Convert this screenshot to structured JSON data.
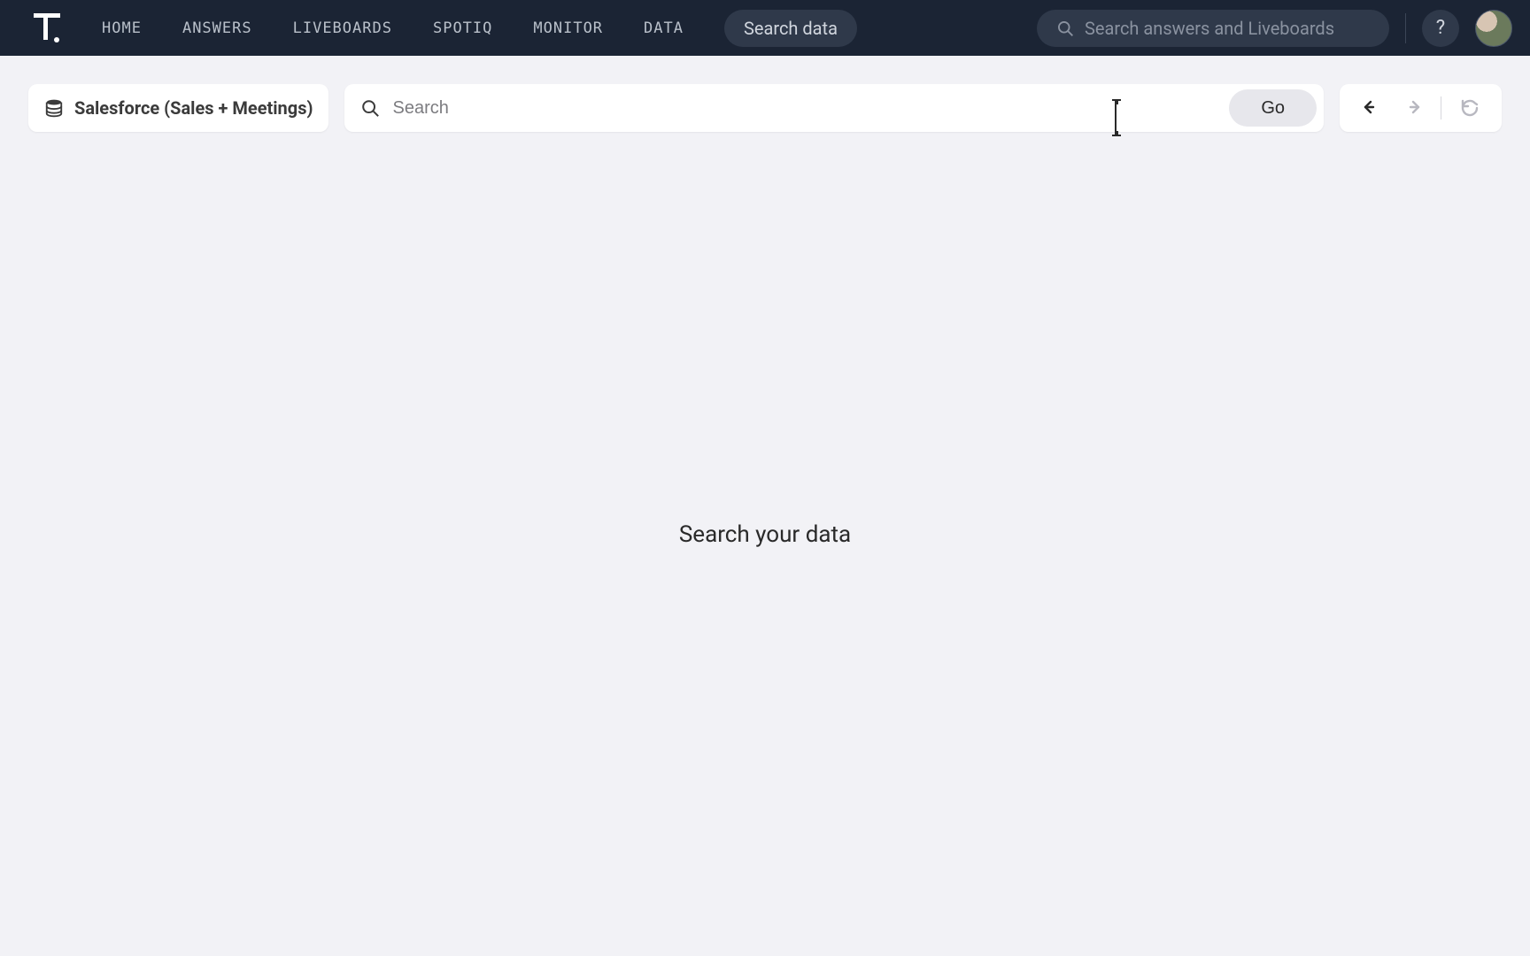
{
  "nav": {
    "items": [
      "HOME",
      "ANSWERS",
      "LIVEBOARDS",
      "SPOTIQ",
      "MONITOR",
      "DATA"
    ],
    "search_data_label": "Search data",
    "global_search_placeholder": "Search answers and Liveboards",
    "help_label": "?"
  },
  "data_source": {
    "label": "Salesforce (Sales + Meetings)"
  },
  "search": {
    "placeholder": "Search",
    "go_label": "Go"
  },
  "empty_state": {
    "headline": "Search your data"
  },
  "icons": {
    "logo": "thoughtspot-logo-icon",
    "db": "database-icon",
    "search": "search-icon",
    "undo": "undo-icon",
    "redo": "redo-icon",
    "reset": "reset-icon",
    "help": "help-icon",
    "avatar": "user-avatar"
  }
}
